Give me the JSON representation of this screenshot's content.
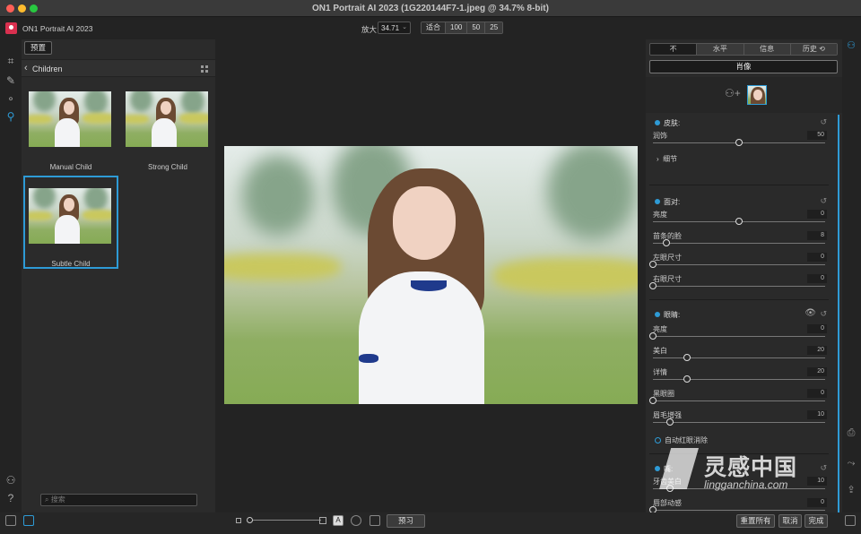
{
  "window": {
    "title": "ON1 Portrait AI 2023 (1G220144F7-1.jpeg @ 34.7% 8-bit)"
  },
  "app": {
    "name": "ON1 Portrait AI 2023"
  },
  "zoom": {
    "label": "放大",
    "value": "34.71",
    "buttons": [
      "适合",
      "100",
      "50",
      "25"
    ]
  },
  "left_panel": {
    "preset_tab": "预置",
    "breadcrumb": "Children",
    "thumbnails": [
      {
        "label": "Manual Child"
      },
      {
        "label": "Strong Child"
      },
      {
        "label": "Subtle Child",
        "selected": true
      }
    ],
    "search_placeholder": "搜索"
  },
  "right_panel": {
    "tabs": [
      "不",
      "水平",
      "信息",
      "历史 ⟲"
    ],
    "portrait_tab": "肖像",
    "skin": {
      "title": "皮肤:",
      "sliders": [
        {
          "label": "润饰",
          "value": "50",
          "pos": 0.5
        }
      ],
      "detail": "细节"
    },
    "face": {
      "title": "面对:",
      "sliders": [
        {
          "label": "亮度",
          "value": "0",
          "pos": 0.5
        },
        {
          "label": "苗条的脸",
          "value": "8",
          "pos": 0.08
        },
        {
          "label": "左眼尺寸",
          "value": "0",
          "pos": 0.0
        },
        {
          "label": "右眼尺寸",
          "value": "0",
          "pos": 0.0
        }
      ]
    },
    "eyes": {
      "title": "眼睛:",
      "sliders": [
        {
          "label": "亮度",
          "value": "0",
          "pos": 0.0
        },
        {
          "label": "美白",
          "value": "20",
          "pos": 0.2
        },
        {
          "label": "详情",
          "value": "20",
          "pos": 0.2
        },
        {
          "label": "黑眼圈",
          "value": "0",
          "pos": 0.0
        },
        {
          "label": "眉毛增强",
          "value": "10",
          "pos": 0.1
        }
      ],
      "checkbox": "自动红眼消除"
    },
    "mouth": {
      "title": "嘴:",
      "sliders": [
        {
          "label": "牙齿美白",
          "value": "10",
          "pos": 0.1
        },
        {
          "label": "唇部动感",
          "value": "0",
          "pos": 0.0
        }
      ]
    }
  },
  "bottom": {
    "preview": "预习",
    "reset_all": "重置所有",
    "cancel": "取消",
    "done": "完成"
  },
  "watermark": {
    "cn": "灵感中国",
    "en": "lingganchina.com"
  },
  "colors": {
    "accent": "#2e9bd6",
    "panel": "#2b2b2b",
    "background": "#232323"
  },
  "icons": [
    "crop-icon",
    "brush-icon",
    "retouch-icon",
    "portrait-icon",
    "person-icon",
    "help-icon",
    "print-icon",
    "share-icon",
    "export-icon"
  ]
}
